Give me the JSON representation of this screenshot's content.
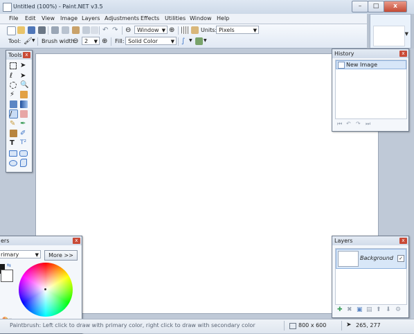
{
  "window": {
    "title": "Untitled (100%) - Paint.NET v3.5",
    "minimize_glyph": "–",
    "maximize_glyph": "□",
    "close_glyph": "x"
  },
  "menubar": {
    "items": [
      "File",
      "Edit",
      "View",
      "Image",
      "Layers",
      "Adjustments",
      "Effects",
      "Utilities",
      "Window",
      "Help"
    ]
  },
  "toolbar": {
    "zoom_value": "Window",
    "units_label": "Units:",
    "units_value": "Pixels",
    "tool_label": "Tool:",
    "brush_width_label": "Brush width:",
    "brush_width_value": "2",
    "fill_label": "Fill:",
    "fill_value": "Solid Color"
  },
  "tools_panel": {
    "title": "Tools",
    "close_glyph": "x",
    "text_tool_glyph": "T",
    "text_tool2_glyph": "T²"
  },
  "history_panel": {
    "title": "History",
    "close_glyph": "x",
    "items": [
      "New Image"
    ]
  },
  "layers_panel": {
    "title": "Layers",
    "close_glyph": "x",
    "layers": [
      {
        "name": "Background",
        "visible": true
      }
    ],
    "visible_glyph": "✓"
  },
  "colors_panel": {
    "title_fragment": "ers",
    "mode_value": "rimary",
    "more_button": "More >>",
    "close_glyph": "x"
  },
  "statusbar": {
    "hint": "Paintbrush: Left click to draw with primary color, right click to draw with secondary color",
    "image_size": "800 x 600",
    "cursor_pos": "265, 277"
  },
  "colors": {
    "accent": "#3d74c7",
    "close_red": "#c94a36",
    "canvas": "#ffffff"
  }
}
